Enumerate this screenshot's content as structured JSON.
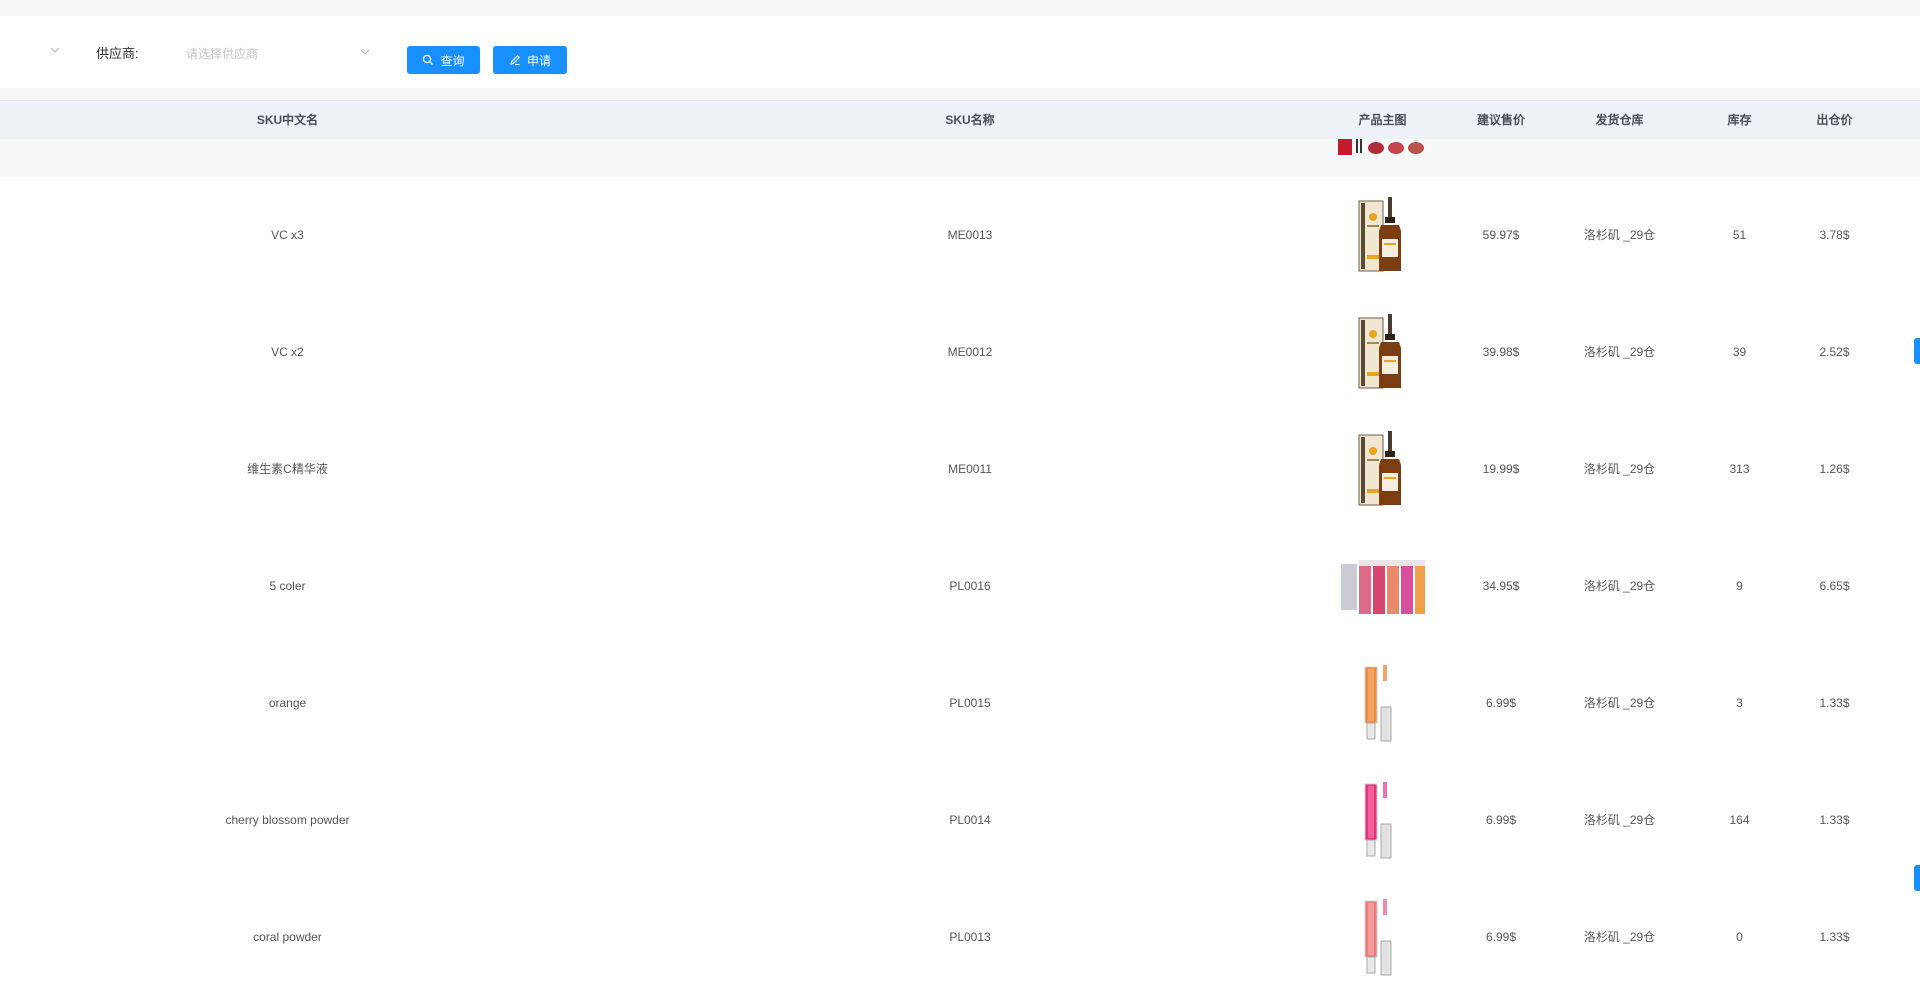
{
  "filter": {
    "supplier_label": "供应商:",
    "supplier_placeholder": "请选择供应商",
    "search_button": "查询",
    "apply_button": "申请"
  },
  "table": {
    "headers": {
      "sku_cn_name": "SKU中文名",
      "sku_name": "SKU名称",
      "main_image": "产品主图",
      "suggested_price": "建议售价",
      "warehouse": "发货仓库",
      "stock": "库存",
      "out_price": "出仓价"
    },
    "rows": [
      {
        "cn_name": "VC x3",
        "sku": "ME0013",
        "image": "serum-bottle-icon",
        "price": "59.97$",
        "warehouse": "洛杉矶 _29仓",
        "stock": "51",
        "out_price": "3.78$"
      },
      {
        "cn_name": "VC x2",
        "sku": "ME0012",
        "image": "serum-bottle-icon",
        "price": "39.98$",
        "warehouse": "洛杉矶 _29仓",
        "stock": "39",
        "out_price": "2.52$"
      },
      {
        "cn_name": "维生素C精华液",
        "sku": "ME0011",
        "image": "serum-bottle-icon",
        "price": "19.99$",
        "warehouse": "洛杉矶 _29仓",
        "stock": "313",
        "out_price": "1.26$"
      },
      {
        "cn_name": "5 coler",
        "sku": "PL0016",
        "image": "lipgloss-set-icon",
        "price": "34.95$",
        "warehouse": "洛杉矶 _29仓",
        "stock": "9",
        "out_price": "6.65$"
      },
      {
        "cn_name": "orange",
        "sku": "PL0015",
        "image": "lipgloss-orange-icon",
        "price": "6.99$",
        "warehouse": "洛杉矶 _29仓",
        "stock": "3",
        "out_price": "1.33$"
      },
      {
        "cn_name": "cherry blossom powder",
        "sku": "PL0014",
        "image": "lipgloss-pink-icon",
        "price": "6.99$",
        "warehouse": "洛杉矶 _29仓",
        "stock": "164",
        "out_price": "1.33$"
      },
      {
        "cn_name": "coral powder",
        "sku": "PL0013",
        "image": "lipgloss-coral-icon",
        "price": "6.99$",
        "warehouse": "洛杉矶 _29仓",
        "stock": "0",
        "out_price": "1.33$"
      }
    ]
  },
  "colors": {
    "primary": "#1890ff",
    "header_bg": "#eef1f6",
    "orange": "#f08a3c",
    "pink": "#e8327a",
    "coral": "#ef7a7a"
  }
}
